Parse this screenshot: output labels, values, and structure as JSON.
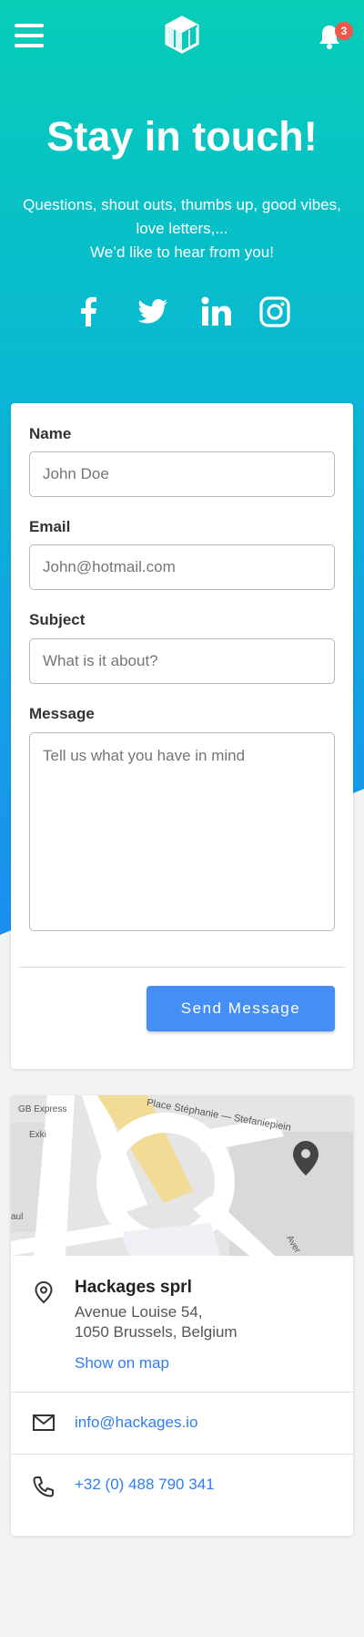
{
  "header": {
    "menu_icon": "hamburger-menu-icon",
    "logo_icon": "hackages-cube-logo",
    "notification_icon": "bell-icon",
    "notification_count": "3"
  },
  "hero": {
    "title": "Stay in touch!",
    "subtitle_line1": "Questions, shout outs, thumbs up, good vibes,",
    "subtitle_line2": "love letters,...",
    "subtitle_line3": "We’d like to hear from you!",
    "socials": [
      "facebook-icon",
      "twitter-icon",
      "linkedin-icon",
      "instagram-icon"
    ]
  },
  "form": {
    "name_label": "Name",
    "name_placeholder": "John Doe",
    "email_label": "Email",
    "email_placeholder": "John@hotmail.com",
    "subject_label": "Subject",
    "subject_placeholder": "What is it about?",
    "message_label": "Message",
    "message_placeholder": "Tell us what you have in mind",
    "send_label": "Send Message"
  },
  "map": {
    "labels": [
      "GB Express",
      "Exki",
      "Place Stéphanie — Stefaniepiein",
      "aul",
      "Aver"
    ]
  },
  "contact": {
    "company": "Hackages sprl",
    "address_line1": "Avenue Louise 54,",
    "address_line2": "1050 Brussels, Belgium",
    "show_map": "Show on map",
    "email": "info@hackages.io",
    "phone": "+32 (0) 488 790 341"
  },
  "colors": {
    "gradient_top": "#07cdb7",
    "gradient_bottom": "#1c8ef1",
    "button": "#448ef5",
    "link": "#2f7df0",
    "badge": "#f0564a"
  }
}
